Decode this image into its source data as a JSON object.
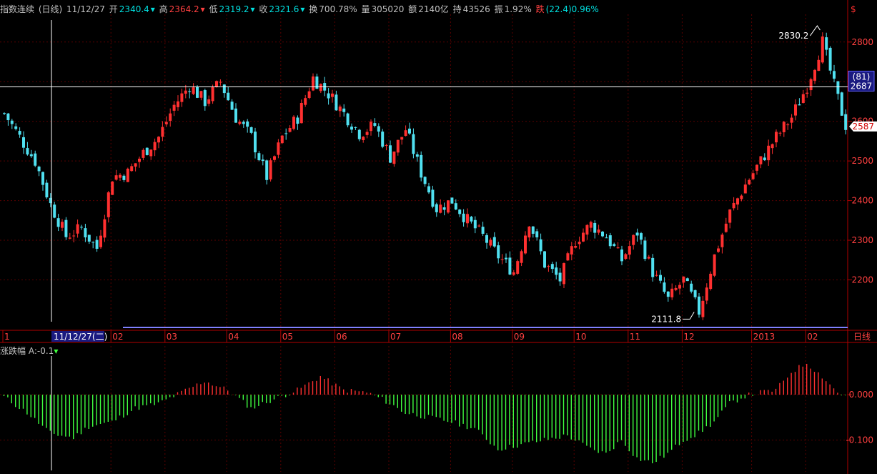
{
  "header": {
    "title": "指数连续",
    "period": "(日线)",
    "date": "11/12/27",
    "open_label": "开",
    "open": "2340.4",
    "high_label": "高",
    "high": "2364.2",
    "low_label": "低",
    "low": "2319.2",
    "close_label": "收",
    "close": "2321.6",
    "turnover_label": "换",
    "turnover": "700.78%",
    "volume_label": "量",
    "volume": "305020",
    "amount_label": "额",
    "amount": "2140亿",
    "oi_label": "持",
    "oi": "43526",
    "amp_label": "振",
    "amp": "1.92%",
    "chg_label": "跌",
    "chg": "(22.4)0.96%",
    "currency_icon": "$"
  },
  "crosshair_date_label": "11/12/27(二)",
  "period_tag": "日线",
  "sub_indicator": {
    "name": "涨跌幅",
    "value_label": "A:-0.1"
  },
  "colors": {
    "up": "#ff3030",
    "down": "#50e0f0",
    "osc_up": "#ff3030",
    "osc_down": "#40ff40",
    "axis": "#b00000",
    "grid": "#5a0000"
  },
  "chart_data": [
    {
      "type": "candlestick",
      "price_axis_ticks": [
        2800,
        2700,
        2600,
        2500,
        2400,
        2300,
        2200
      ],
      "ylim": [
        2080,
        2870
      ],
      "month_labels": [
        "1",
        "02",
        "03",
        "04",
        "05",
        "06",
        "07",
        "08",
        "09",
        "10",
        "11",
        "12",
        "2013",
        "02"
      ],
      "annotations": [
        {
          "text": "2830.2",
          "value": 2830.2
        },
        {
          "text": "2111.8",
          "value": 2111.8
        }
      ],
      "crosshair_value": "2687",
      "crosshair_count": "(81)",
      "last_price": "2587",
      "close_path": [
        [
          0,
          2620
        ],
        [
          4,
          2560
        ],
        [
          8,
          2500
        ],
        [
          12,
          2390
        ],
        [
          16,
          2310
        ],
        [
          20,
          2330
        ],
        [
          24,
          2280
        ],
        [
          28,
          2460
        ],
        [
          32,
          2470
        ],
        [
          36,
          2520
        ],
        [
          40,
          2560
        ],
        [
          44,
          2640
        ],
        [
          48,
          2690
        ],
        [
          52,
          2650
        ],
        [
          56,
          2700
        ],
        [
          60,
          2610
        ],
        [
          64,
          2560
        ],
        [
          68,
          2460
        ],
        [
          72,
          2560
        ],
        [
          76,
          2610
        ],
        [
          80,
          2710
        ],
        [
          84,
          2670
        ],
        [
          88,
          2620
        ],
        [
          92,
          2570
        ],
        [
          96,
          2590
        ],
        [
          100,
          2510
        ],
        [
          104,
          2580
        ],
        [
          108,
          2470
        ],
        [
          112,
          2380
        ],
        [
          116,
          2400
        ],
        [
          120,
          2350
        ],
        [
          124,
          2310
        ],
        [
          128,
          2260
        ],
        [
          132,
          2220
        ],
        [
          136,
          2350
        ],
        [
          140,
          2240
        ],
        [
          144,
          2200
        ],
        [
          148,
          2300
        ],
        [
          152,
          2340
        ],
        [
          156,
          2310
        ],
        [
          160,
          2250
        ],
        [
          164,
          2320
        ],
        [
          168,
          2220
        ],
        [
          172,
          2150
        ],
        [
          176,
          2200
        ],
        [
          180,
          2120
        ],
        [
          184,
          2260
        ],
        [
          188,
          2370
        ],
        [
          192,
          2440
        ],
        [
          196,
          2500
        ],
        [
          200,
          2560
        ],
        [
          204,
          2610
        ],
        [
          208,
          2690
        ],
        [
          212,
          2800
        ],
        [
          215,
          2690
        ],
        [
          218,
          2590
        ]
      ]
    },
    {
      "type": "bar",
      "name": "涨跌幅",
      "axis_ticks": [
        "0.000",
        "-0.100"
      ],
      "ylim": [
        -0.17,
        0.085
      ],
      "envelope": [
        [
          0,
          -0.005
        ],
        [
          6,
          -0.04
        ],
        [
          12,
          -0.085
        ],
        [
          18,
          -0.095
        ],
        [
          22,
          -0.07
        ],
        [
          28,
          -0.06
        ],
        [
          34,
          -0.03
        ],
        [
          40,
          -0.02
        ],
        [
          46,
          0.005
        ],
        [
          52,
          0.03
        ],
        [
          58,
          0.01
        ],
        [
          64,
          -0.03
        ],
        [
          70,
          -0.01
        ],
        [
          76,
          0.01
        ],
        [
          82,
          0.04
        ],
        [
          88,
          0.01
        ],
        [
          94,
          0.005
        ],
        [
          98,
          -0.01
        ],
        [
          104,
          -0.04
        ],
        [
          110,
          -0.05
        ],
        [
          116,
          -0.06
        ],
        [
          122,
          -0.075
        ],
        [
          128,
          -0.12
        ],
        [
          134,
          -0.11
        ],
        [
          140,
          -0.1
        ],
        [
          146,
          -0.09
        ],
        [
          152,
          -0.12
        ],
        [
          156,
          -0.13
        ],
        [
          160,
          -0.1
        ],
        [
          164,
          -0.14
        ],
        [
          168,
          -0.15
        ],
        [
          172,
          -0.13
        ],
        [
          176,
          -0.1
        ],
        [
          180,
          -0.085
        ],
        [
          184,
          -0.06
        ],
        [
          188,
          -0.02
        ],
        [
          192,
          -0.003
        ],
        [
          196,
          0.005
        ],
        [
          200,
          0.01
        ],
        [
          204,
          0.05
        ],
        [
          208,
          0.07
        ],
        [
          212,
          0.04
        ],
        [
          216,
          0.005
        ],
        [
          218,
          -0.003
        ]
      ]
    }
  ]
}
